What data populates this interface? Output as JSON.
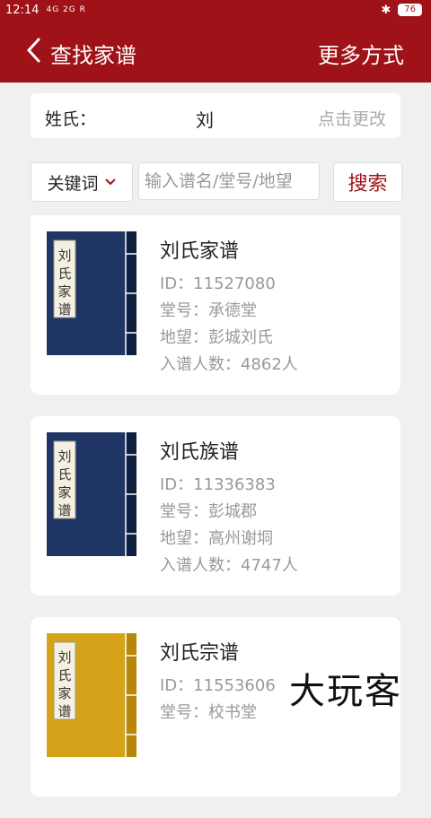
{
  "status_bar": {
    "time": "12:14",
    "signal": "4G 2G R",
    "battery": "76"
  },
  "header": {
    "back_label": "查找家谱",
    "more_label": "更多方式"
  },
  "surname": {
    "label": "姓氏：",
    "value": "刘",
    "change_label": "点击更改"
  },
  "search": {
    "keyword_select": "关键词",
    "input_placeholder": "输入谱名/堂号/地望",
    "button_label": "搜索"
  },
  "results": [
    {
      "title": "刘氏家谱",
      "id": "ID：11527080",
      "hall": "堂号：承德堂",
      "location": "地望：彭城刘氏",
      "count": "入谱人数：4862人",
      "cover_label": "刘氏家谱",
      "cover_style": "blue"
    },
    {
      "title": "刘氏族谱",
      "id": "ID：11336383",
      "hall": "堂号：彭城郡",
      "location": "地望：高州谢垌",
      "count": "入谱人数：4747人",
      "cover_label": "刘氏家谱",
      "cover_style": "blue"
    },
    {
      "title": "刘氏宗谱",
      "id": "ID：11553606",
      "hall": "堂号：校书堂",
      "location": "",
      "count": "",
      "cover_label": "刘氏家谱",
      "cover_style": "gold"
    }
  ],
  "watermark": "大玩客",
  "colors": {
    "brand": "#9f1217",
    "book_blue": "#1f3564",
    "book_gold": "#d4a31a"
  }
}
